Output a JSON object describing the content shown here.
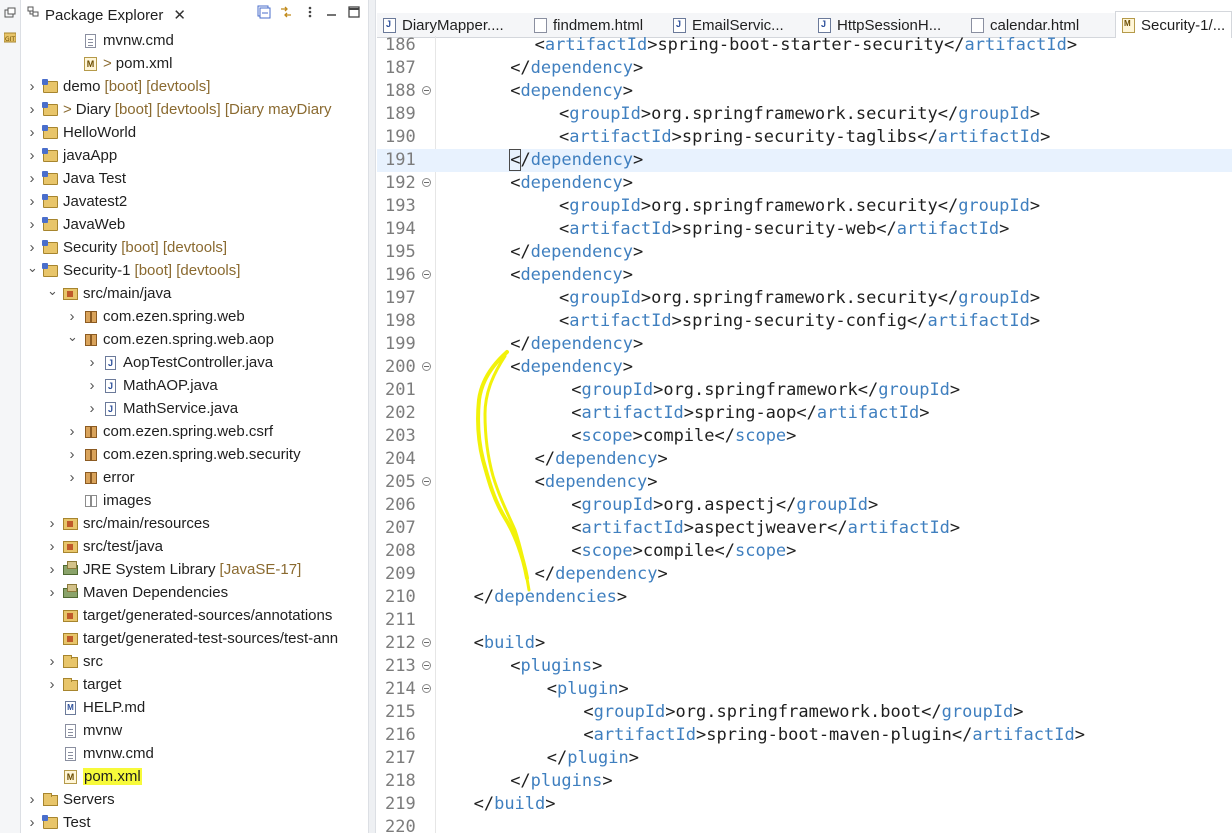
{
  "package_explorer": {
    "title": "Package Explorer",
    "close_glyph": "✕",
    "rows": [
      {
        "depth": 2,
        "expand": "",
        "icon": "file",
        "label": "mvnw.cmd"
      },
      {
        "depth": 2,
        "expand": "",
        "icon": "xml",
        "prefix": ">",
        "label": "pom.xml"
      },
      {
        "depth": 0,
        "expand": "collapsed",
        "icon": "project",
        "label": "demo",
        "deco": "[boot] [devtools]"
      },
      {
        "depth": 0,
        "expand": "collapsed",
        "icon": "project",
        "prefix": ">",
        "label": "Diary",
        "deco": "[boot] [devtools] [Diary mayDiary"
      },
      {
        "depth": 0,
        "expand": "collapsed",
        "icon": "project",
        "label": "HelloWorld"
      },
      {
        "depth": 0,
        "expand": "collapsed",
        "icon": "project",
        "label": "javaApp"
      },
      {
        "depth": 0,
        "expand": "collapsed",
        "icon": "project",
        "label": "Java Test"
      },
      {
        "depth": 0,
        "expand": "collapsed",
        "icon": "project",
        "label": "Javatest2"
      },
      {
        "depth": 0,
        "expand": "collapsed",
        "icon": "project",
        "label": "JavaWeb"
      },
      {
        "depth": 0,
        "expand": "collapsed",
        "icon": "project",
        "label": "Security",
        "deco": "[boot] [devtools]"
      },
      {
        "depth": 0,
        "expand": "expanded",
        "icon": "project",
        "label": "Security-1",
        "deco": "[boot] [devtools]"
      },
      {
        "depth": 1,
        "expand": "expanded",
        "icon": "srcfolder",
        "label": "src/main/java"
      },
      {
        "depth": 2,
        "expand": "collapsed",
        "icon": "package",
        "label": "com.ezen.spring.web"
      },
      {
        "depth": 2,
        "expand": "expanded",
        "icon": "package",
        "label": "com.ezen.spring.web.aop"
      },
      {
        "depth": 3,
        "expand": "collapsed",
        "icon": "java",
        "label": "AopTestController.java"
      },
      {
        "depth": 3,
        "expand": "collapsed",
        "icon": "java",
        "label": "MathAOP.java"
      },
      {
        "depth": 3,
        "expand": "collapsed",
        "icon": "java",
        "label": "MathService.java"
      },
      {
        "depth": 2,
        "expand": "collapsed",
        "icon": "package",
        "label": "com.ezen.spring.web.csrf"
      },
      {
        "depth": 2,
        "expand": "collapsed",
        "icon": "package",
        "label": "com.ezen.spring.web.security"
      },
      {
        "depth": 2,
        "expand": "collapsed",
        "icon": "package",
        "label": "error"
      },
      {
        "depth": 2,
        "expand": "",
        "icon": "package-empty",
        "label": "images"
      },
      {
        "depth": 1,
        "expand": "collapsed",
        "icon": "srcfolder",
        "label": "src/main/resources"
      },
      {
        "depth": 1,
        "expand": "collapsed",
        "icon": "srcfolder",
        "label": "src/test/java"
      },
      {
        "depth": 1,
        "expand": "collapsed",
        "icon": "library",
        "label": "JRE System Library",
        "deco": "[JavaSE-17]"
      },
      {
        "depth": 1,
        "expand": "collapsed",
        "icon": "library",
        "label": "Maven Dependencies"
      },
      {
        "depth": 1,
        "expand": "",
        "icon": "srcfolder",
        "label": "target/generated-sources/annotations"
      },
      {
        "depth": 1,
        "expand": "",
        "icon": "srcfolder",
        "label": "target/generated-test-sources/test-ann"
      },
      {
        "depth": 1,
        "expand": "collapsed",
        "icon": "folder",
        "label": "src"
      },
      {
        "depth": 1,
        "expand": "collapsed",
        "icon": "folder",
        "label": "target"
      },
      {
        "depth": 1,
        "expand": "",
        "icon": "md",
        "label": "HELP.md"
      },
      {
        "depth": 1,
        "expand": "",
        "icon": "file",
        "label": "mvnw"
      },
      {
        "depth": 1,
        "expand": "",
        "icon": "file",
        "label": "mvnw.cmd"
      },
      {
        "depth": 1,
        "expand": "",
        "icon": "xml",
        "label": "pom.xml",
        "highlight": true
      },
      {
        "depth": 0,
        "expand": "collapsed",
        "icon": "folder",
        "label": "Servers"
      },
      {
        "depth": 0,
        "expand": "collapsed",
        "icon": "project",
        "label": "Test"
      }
    ]
  },
  "editor": {
    "tabs": [
      {
        "label": "DiaryMapper....",
        "icon": "java"
      },
      {
        "label": "findmem.html",
        "icon": "file"
      },
      {
        "label": "EmailServic...",
        "icon": "java"
      },
      {
        "label": "HttpSessionH...",
        "icon": "java"
      },
      {
        "label": "calendar.html",
        "icon": "file"
      },
      {
        "label": "Security-1/...",
        "icon": "xml",
        "active": true
      }
    ],
    "lines": [
      {
        "n": "186",
        "indent": 4,
        "parts": [
          [
            "t",
            "<"
          ],
          [
            "k",
            "artifactId"
          ],
          [
            "t",
            ">spring-boot-starter-security</"
          ],
          [
            "k",
            "artifactId"
          ],
          [
            "t",
            ">"
          ]
        ]
      },
      {
        "n": "187",
        "indent": 3,
        "parts": [
          [
            "t",
            "</"
          ],
          [
            "k",
            "dependency"
          ],
          [
            "t",
            ">"
          ]
        ]
      },
      {
        "n": "188",
        "indent": 3,
        "fold": true,
        "parts": [
          [
            "t",
            "<"
          ],
          [
            "k",
            "dependency"
          ],
          [
            "t",
            ">"
          ]
        ]
      },
      {
        "n": "189",
        "indent": 5,
        "parts": [
          [
            "t",
            "<"
          ],
          [
            "k",
            "groupId"
          ],
          [
            "t",
            ">org.springframework.security</"
          ],
          [
            "k",
            "groupId"
          ],
          [
            "t",
            ">"
          ]
        ]
      },
      {
        "n": "190",
        "indent": 5,
        "parts": [
          [
            "t",
            "<"
          ],
          [
            "k",
            "artifactId"
          ],
          [
            "t",
            ">spring-security-taglibs</"
          ],
          [
            "k",
            "artifactId"
          ],
          [
            "t",
            ">"
          ]
        ]
      },
      {
        "n": "191",
        "indent": 3,
        "current": true,
        "parts": [
          [
            "c",
            "<"
          ],
          [
            "t",
            "/"
          ],
          [
            "k",
            "dependency"
          ],
          [
            "t",
            ">"
          ]
        ]
      },
      {
        "n": "192",
        "indent": 3,
        "fold": true,
        "parts": [
          [
            "t",
            "<"
          ],
          [
            "k",
            "dependency"
          ],
          [
            "t",
            ">"
          ]
        ]
      },
      {
        "n": "193",
        "indent": 5,
        "parts": [
          [
            "t",
            "<"
          ],
          [
            "k",
            "groupId"
          ],
          [
            "t",
            ">org.springframework.security</"
          ],
          [
            "k",
            "groupId"
          ],
          [
            "t",
            ">"
          ]
        ]
      },
      {
        "n": "194",
        "indent": 5,
        "parts": [
          [
            "t",
            "<"
          ],
          [
            "k",
            "artifactId"
          ],
          [
            "t",
            ">spring-security-web</"
          ],
          [
            "k",
            "artifactId"
          ],
          [
            "t",
            ">"
          ]
        ]
      },
      {
        "n": "195",
        "indent": 3,
        "parts": [
          [
            "t",
            "</"
          ],
          [
            "k",
            "dependency"
          ],
          [
            "t",
            ">"
          ]
        ]
      },
      {
        "n": "196",
        "indent": 3,
        "fold": true,
        "parts": [
          [
            "t",
            "<"
          ],
          [
            "k",
            "dependency"
          ],
          [
            "t",
            ">"
          ]
        ]
      },
      {
        "n": "197",
        "indent": 5,
        "parts": [
          [
            "t",
            "<"
          ],
          [
            "k",
            "groupId"
          ],
          [
            "t",
            ">org.springframework.security</"
          ],
          [
            "k",
            "groupId"
          ],
          [
            "t",
            ">"
          ]
        ]
      },
      {
        "n": "198",
        "indent": 5,
        "parts": [
          [
            "t",
            "<"
          ],
          [
            "k",
            "artifactId"
          ],
          [
            "t",
            ">spring-security-config</"
          ],
          [
            "k",
            "artifactId"
          ],
          [
            "t",
            ">"
          ]
        ]
      },
      {
        "n": "199",
        "indent": 3,
        "parts": [
          [
            "t",
            "</"
          ],
          [
            "k",
            "dependency"
          ],
          [
            "t",
            ">"
          ]
        ]
      },
      {
        "n": "200",
        "indent": 3,
        "fold": true,
        "parts": [
          [
            "t",
            "<"
          ],
          [
            "k",
            "dependency"
          ],
          [
            "t",
            ">"
          ]
        ]
      },
      {
        "n": "201",
        "indent": 5.5,
        "parts": [
          [
            "t",
            "<"
          ],
          [
            "k",
            "groupId"
          ],
          [
            "t",
            ">org.springframework</"
          ],
          [
            "k",
            "groupId"
          ],
          [
            "t",
            ">"
          ]
        ]
      },
      {
        "n": "202",
        "indent": 5.5,
        "parts": [
          [
            "t",
            "<"
          ],
          [
            "k",
            "artifactId"
          ],
          [
            "t",
            ">spring-aop</"
          ],
          [
            "k",
            "artifactId"
          ],
          [
            "t",
            ">"
          ]
        ]
      },
      {
        "n": "203",
        "indent": 5.5,
        "parts": [
          [
            "t",
            "<"
          ],
          [
            "k",
            "scope"
          ],
          [
            "t",
            ">compile</"
          ],
          [
            "k",
            "scope"
          ],
          [
            "t",
            ">"
          ]
        ]
      },
      {
        "n": "204",
        "indent": 4,
        "parts": [
          [
            "t",
            "</"
          ],
          [
            "k",
            "dependency"
          ],
          [
            "t",
            ">"
          ]
        ]
      },
      {
        "n": "205",
        "indent": 4,
        "fold": true,
        "parts": [
          [
            "t",
            "<"
          ],
          [
            "k",
            "dependency"
          ],
          [
            "t",
            ">"
          ]
        ]
      },
      {
        "n": "206",
        "indent": 5.5,
        "parts": [
          [
            "t",
            "<"
          ],
          [
            "k",
            "groupId"
          ],
          [
            "t",
            ">org.aspectj</"
          ],
          [
            "k",
            "groupId"
          ],
          [
            "t",
            ">"
          ]
        ]
      },
      {
        "n": "207",
        "indent": 5.5,
        "parts": [
          [
            "t",
            "<"
          ],
          [
            "k",
            "artifactId"
          ],
          [
            "t",
            ">aspectjweaver</"
          ],
          [
            "k",
            "artifactId"
          ],
          [
            "t",
            ">"
          ]
        ]
      },
      {
        "n": "208",
        "indent": 5.5,
        "parts": [
          [
            "t",
            "<"
          ],
          [
            "k",
            "scope"
          ],
          [
            "t",
            ">compile</"
          ],
          [
            "k",
            "scope"
          ],
          [
            "t",
            ">"
          ]
        ]
      },
      {
        "n": "209",
        "indent": 4,
        "parts": [
          [
            "t",
            "</"
          ],
          [
            "k",
            "dependency"
          ],
          [
            "t",
            ">"
          ]
        ]
      },
      {
        "n": "210",
        "indent": 1.5,
        "parts": [
          [
            "t",
            "</"
          ],
          [
            "k",
            "dependencies"
          ],
          [
            "t",
            ">"
          ]
        ]
      },
      {
        "n": "211",
        "indent": 0,
        "parts": []
      },
      {
        "n": "212",
        "indent": 1.5,
        "fold": true,
        "parts": [
          [
            "t",
            "<"
          ],
          [
            "k",
            "build"
          ],
          [
            "t",
            ">"
          ]
        ]
      },
      {
        "n": "213",
        "indent": 3,
        "fold": true,
        "parts": [
          [
            "t",
            "<"
          ],
          [
            "k",
            "plugins"
          ],
          [
            "t",
            ">"
          ]
        ]
      },
      {
        "n": "214",
        "indent": 4.5,
        "fold": true,
        "parts": [
          [
            "t",
            "<"
          ],
          [
            "k",
            "plugin"
          ],
          [
            "t",
            ">"
          ]
        ]
      },
      {
        "n": "215",
        "indent": 6,
        "parts": [
          [
            "t",
            "<"
          ],
          [
            "k",
            "groupId"
          ],
          [
            "t",
            ">org.springframework.boot</"
          ],
          [
            "k",
            "groupId"
          ],
          [
            "t",
            ">"
          ]
        ]
      },
      {
        "n": "216",
        "indent": 6,
        "parts": [
          [
            "t",
            "<"
          ],
          [
            "k",
            "artifactId"
          ],
          [
            "t",
            ">spring-boot-maven-plugin</"
          ],
          [
            "k",
            "artifactId"
          ],
          [
            "t",
            ">"
          ]
        ]
      },
      {
        "n": "217",
        "indent": 4.5,
        "parts": [
          [
            "t",
            "</"
          ],
          [
            "k",
            "plugin"
          ],
          [
            "t",
            ">"
          ]
        ]
      },
      {
        "n": "218",
        "indent": 3,
        "parts": [
          [
            "t",
            "</"
          ],
          [
            "k",
            "plugins"
          ],
          [
            "t",
            ">"
          ]
        ]
      },
      {
        "n": "219",
        "indent": 1.5,
        "parts": [
          [
            "t",
            "</"
          ],
          [
            "k",
            "build"
          ],
          [
            "t",
            ">"
          ]
        ]
      },
      {
        "n": "220",
        "indent": 0,
        "parts": []
      }
    ]
  },
  "colors": {
    "tag": "#3f7fbf",
    "annotation_stroke": "#f2f20a",
    "selection_highlight": "#f7fa3a",
    "current_line": "#e8f2fe"
  }
}
